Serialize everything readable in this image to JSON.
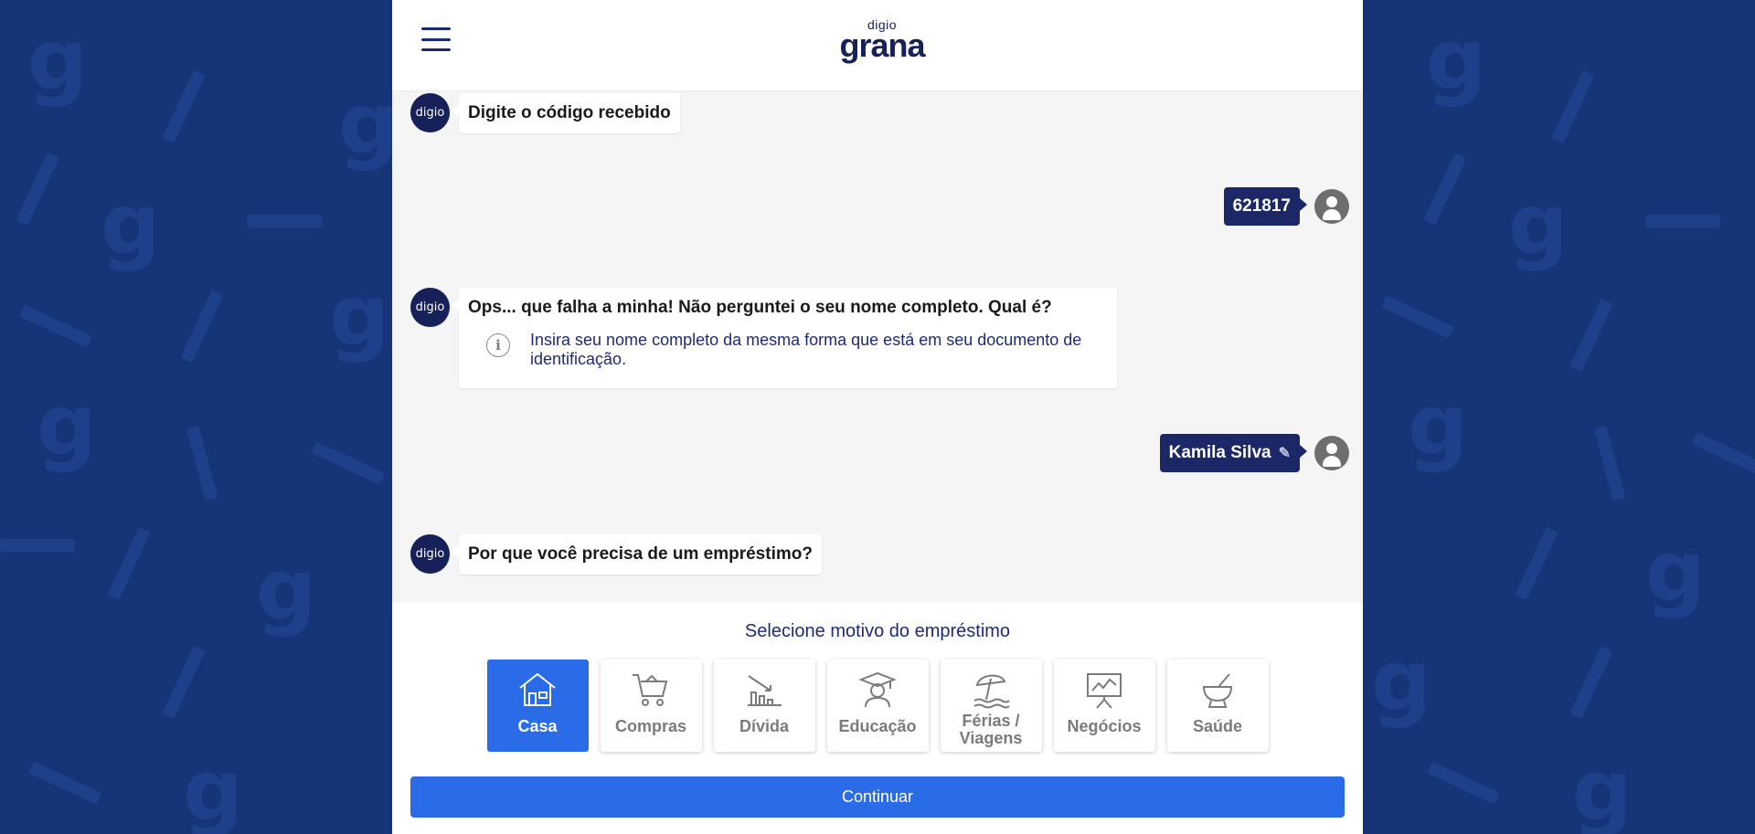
{
  "header": {
    "logo_small": "digio",
    "logo_big": "grana"
  },
  "bot_avatar_text": "digio",
  "messages": {
    "m1": "Digite o código recebido",
    "m2": "621817",
    "m3": "Ops... que falha a minha! Não perguntei o seu nome completo. Qual é?",
    "m3_hint": "Insira seu nome completo da mesma forma que está em seu documento de identificação.",
    "m4": "Kamila Silva",
    "m5": "Por que você precisa de um empréstimo?"
  },
  "selection": {
    "title": "Selecione motivo do empréstimo",
    "options": [
      {
        "label": "Casa",
        "icon": "house-icon",
        "selected": true
      },
      {
        "label": "Compras",
        "icon": "cart-icon",
        "selected": false
      },
      {
        "label": "Dívida",
        "icon": "debt-chart-icon",
        "selected": false
      },
      {
        "label": "Educação",
        "icon": "graduate-icon",
        "selected": false
      },
      {
        "label": "Férias / Viagens",
        "icon": "beach-umbrella-icon",
        "selected": false
      },
      {
        "label": "Negócios",
        "icon": "presentation-board-icon",
        "selected": false
      },
      {
        "label": "Saúde",
        "icon": "mortar-pestle-icon",
        "selected": false
      }
    ],
    "continue_label": "Continuar"
  },
  "colors": {
    "background": "#163478",
    "accent": "#2a6be8",
    "brand_dark": "#16215a"
  }
}
